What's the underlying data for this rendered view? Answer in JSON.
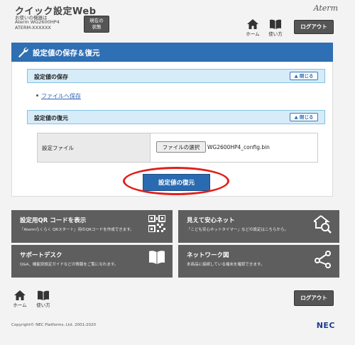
{
  "header": {
    "app_title": "クイック設定Web",
    "device_lines": [
      "お使いの機器は",
      "Aterm WG2600HP4",
      "ATERM-XXXXXX"
    ],
    "status_button": [
      "現在の",
      "状態"
    ],
    "home_label": "ホーム",
    "howto_label": "使い方",
    "logout_label": "ログアウト",
    "brand": "Aterm"
  },
  "panel": {
    "title": "設定値の保存＆復元",
    "save_section": {
      "label": "設定値の保存",
      "close_label": "閉じる"
    },
    "save_link": "ファイルへ保存",
    "restore_section": {
      "label": "設定値の復元",
      "close_label": "閉じる"
    },
    "file_row": {
      "label": "設定ファイル",
      "choose_button": "ファイルの選択",
      "file_name": "WG2600HP4_config.bin"
    },
    "restore_button": "設定値の復元"
  },
  "tiles": [
    {
      "title": "設定用QR コードを表示",
      "desc": "「Atermらくらく QRスタート」用のQRコードを作成できます。",
      "icon": "qr-code-icon"
    },
    {
      "title": "見えて安心ネット",
      "desc": "「こども安心ネットタイマー」などの設定はこちらから。",
      "icon": "house-search-icon"
    },
    {
      "title": "サポートデスク",
      "desc": "Q&A、機能別設定ガイドなどの情報をご覧になれます。",
      "icon": "book-icon"
    },
    {
      "title": "ネットワーク図",
      "desc": "本商品に接続している端末を確認できます。",
      "icon": "network-icon"
    }
  ],
  "footer": {
    "home_label": "ホーム",
    "howto_label": "使い方",
    "logout_label": "ログアウト",
    "copyright": "Copyright© NEC Platforms, Ltd. 2001-2020",
    "nec_logo": "NEC"
  },
  "colors": {
    "accent": "#2f6fb3",
    "highlight": "#e0201a",
    "tile_bg": "#5e5e5e"
  }
}
